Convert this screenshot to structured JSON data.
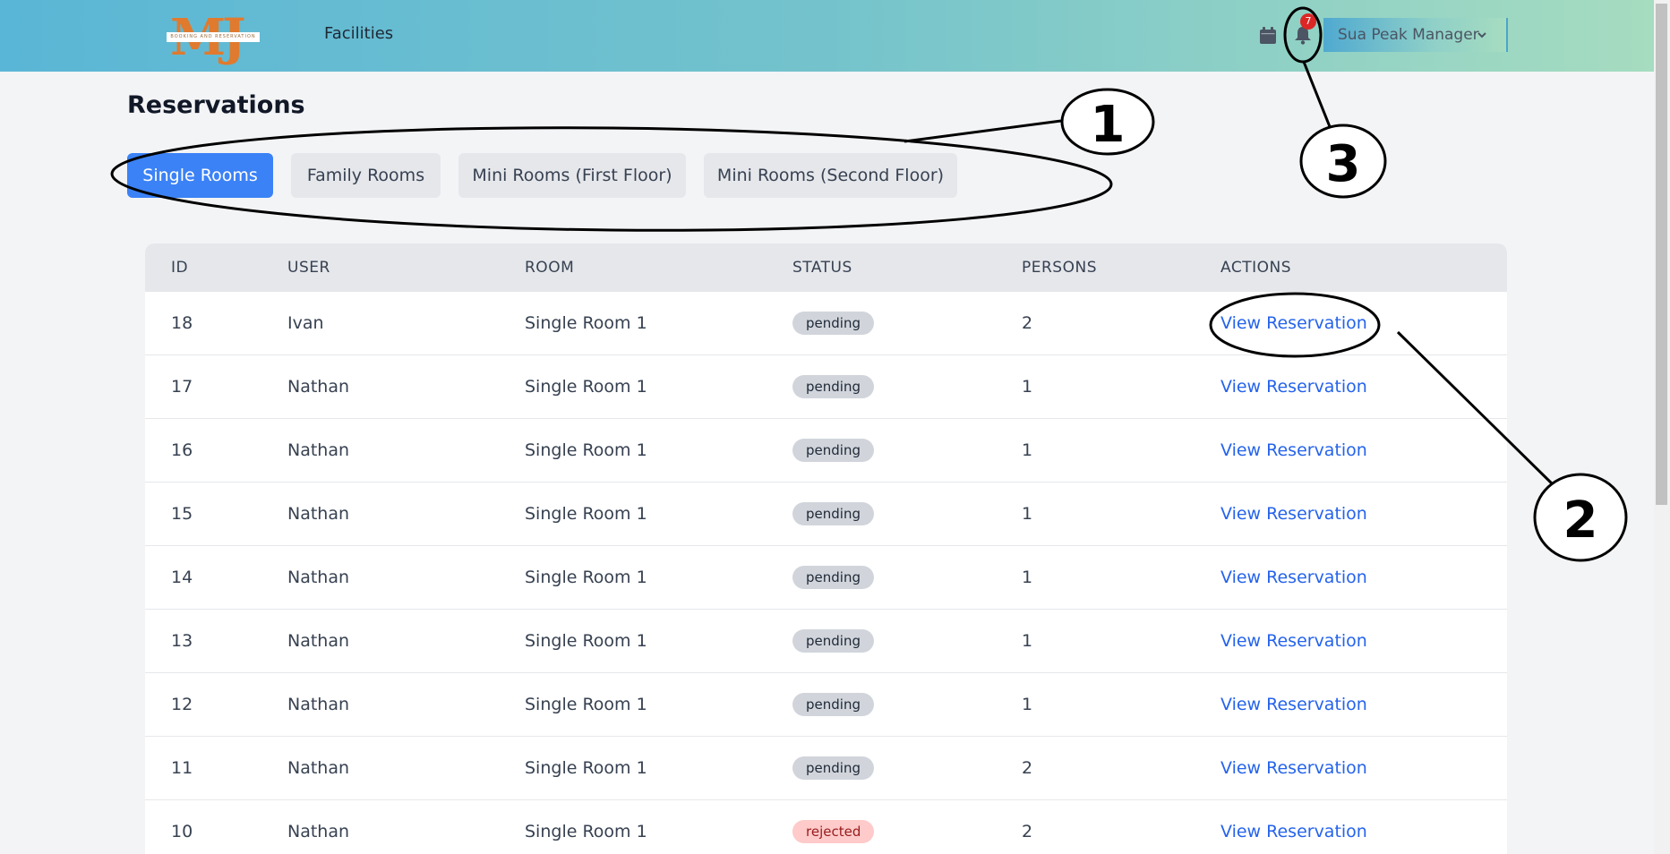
{
  "header": {
    "logo_letters": "MJ",
    "logo_tagline": "BOOKING AND RESERVATION",
    "nav_facilities": "Facilities",
    "notification_count": "7",
    "user_name": "Sua Peak Manager",
    "icons": [
      "calendar-icon",
      "bell-icon",
      "chevron-down-icon"
    ]
  },
  "page": {
    "title": "Reservations",
    "tabs": [
      {
        "label": "Single Rooms",
        "active": true
      },
      {
        "label": "Family Rooms",
        "active": false
      },
      {
        "label": "Mini Rooms (First Floor)",
        "active": false
      },
      {
        "label": "Mini Rooms (Second Floor)",
        "active": false
      }
    ]
  },
  "table": {
    "columns": [
      "ID",
      "USER",
      "ROOM",
      "STATUS",
      "PERSONS",
      "ACTIONS"
    ],
    "rows": [
      {
        "id": "18",
        "user": "Ivan",
        "room": "Single Room 1",
        "status": "pending",
        "persons": "2",
        "action": "View Reservation"
      },
      {
        "id": "17",
        "user": "Nathan",
        "room": "Single Room 1",
        "status": "pending",
        "persons": "1",
        "action": "View Reservation"
      },
      {
        "id": "16",
        "user": "Nathan",
        "room": "Single Room 1",
        "status": "pending",
        "persons": "1",
        "action": "View Reservation"
      },
      {
        "id": "15",
        "user": "Nathan",
        "room": "Single Room 1",
        "status": "pending",
        "persons": "1",
        "action": "View Reservation"
      },
      {
        "id": "14",
        "user": "Nathan",
        "room": "Single Room 1",
        "status": "pending",
        "persons": "1",
        "action": "View Reservation"
      },
      {
        "id": "13",
        "user": "Nathan",
        "room": "Single Room 1",
        "status": "pending",
        "persons": "1",
        "action": "View Reservation"
      },
      {
        "id": "12",
        "user": "Nathan",
        "room": "Single Room 1",
        "status": "pending",
        "persons": "1",
        "action": "View Reservation"
      },
      {
        "id": "11",
        "user": "Nathan",
        "room": "Single Room 1",
        "status": "pending",
        "persons": "2",
        "action": "View Reservation"
      },
      {
        "id": "10",
        "user": "Nathan",
        "room": "Single Room 1",
        "status": "rejected",
        "persons": "2",
        "action": "View Reservation"
      }
    ]
  },
  "annotations": {
    "callout_1": "1",
    "callout_2": "2",
    "callout_3": "3"
  },
  "colors": {
    "header_gradient_start": "#5ab6d6",
    "header_gradient_end": "#a6dcc0",
    "active_tab": "#3b82f6",
    "link": "#2563eb",
    "badge_pending": "#d1d5db",
    "badge_rejected": "#fecaca",
    "notification_badge": "#dc2626"
  }
}
